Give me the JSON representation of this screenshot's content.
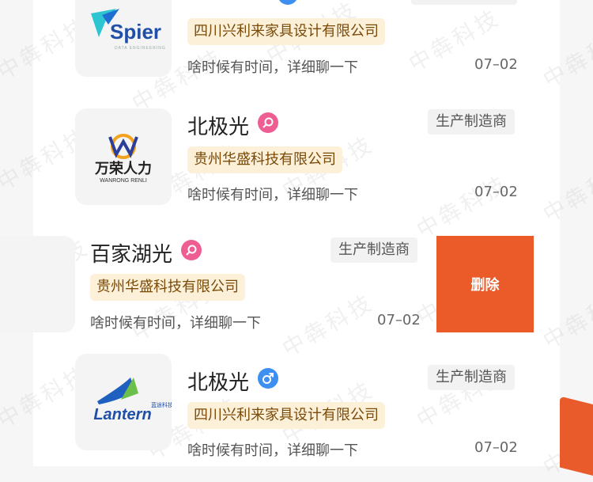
{
  "watermark_text": "中犇科技",
  "colors": {
    "accent": "#eb5b2a",
    "female": "#ee5e93",
    "male": "#3d8ff0",
    "company_bg": "#fdf0d8"
  },
  "delete_label": "删除",
  "items": [
    {
      "name": "",
      "gender": "male-icon",
      "tag": "",
      "company": "四川兴利来家具设计有限公司",
      "message": "啥时候有时间，详细聊一下",
      "date": "07–02",
      "logo": {
        "brand": "Spier",
        "caption": "DATA ENGINEERING"
      }
    },
    {
      "name": "北极光",
      "gender": "female-icon",
      "tag": "生产制造商",
      "company": "贵州华盛科技有限公司",
      "message": "啥时候有时间，详细聊一下",
      "date": "07–02",
      "logo": {
        "brand": "万荣人力",
        "caption": "WANRONG RENLI"
      }
    },
    {
      "name": "百家湖光",
      "gender": "female-icon",
      "tag": "生产制造商",
      "company": "贵州华盛科技有限公司",
      "message": "啥时候有时间，详细聊一下",
      "date": "07–02"
    },
    {
      "name": "北极光",
      "gender": "male-icon",
      "tag": "生产制造商",
      "company": "四川兴利来家具设计有限公司",
      "message": "啥时候有时间，详细聊一下",
      "date": "07–02",
      "logo": {
        "brand": "Lantern",
        "caption": "蓝途科技"
      }
    }
  ]
}
